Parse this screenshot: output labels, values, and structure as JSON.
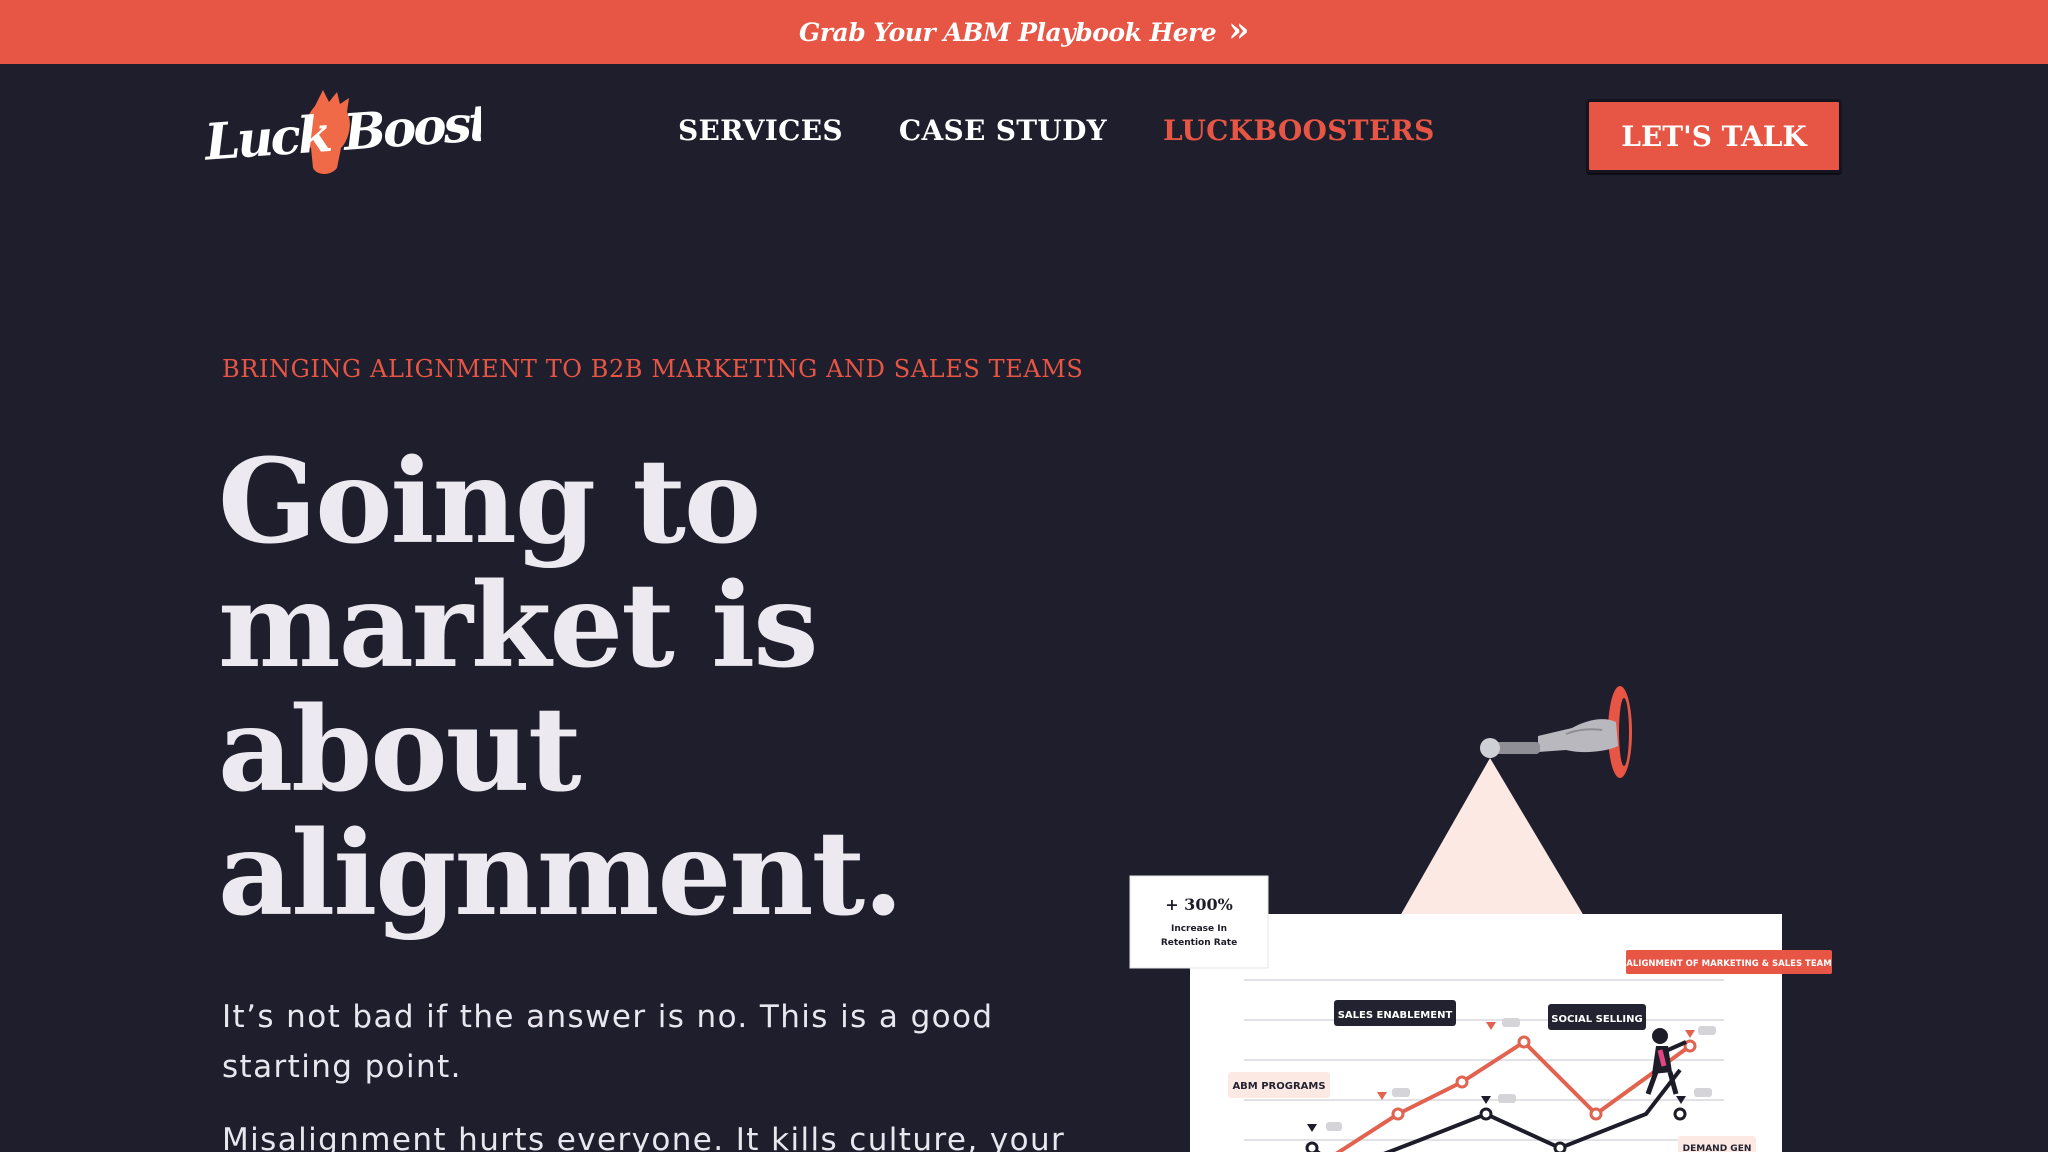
{
  "announcement": {
    "text": "Grab Your ABM Playbook Here",
    "icon": "double-chevron-right-icon"
  },
  "logo": {
    "text": "Luck Boosters",
    "accent_color": "#f06a47"
  },
  "nav": {
    "items": [
      {
        "label": "SERVICES"
      },
      {
        "label": "CASE STUDY"
      },
      {
        "label": "LUCKBOOSTERS"
      }
    ]
  },
  "cta": {
    "label": "LET'S TALK"
  },
  "hero": {
    "eyebrow": "BRINGING ALIGNMENT TO B2B MARKETING AND SALES TEAMS",
    "title": "Going to market is about alignment.",
    "paragraph1": "It’s not bad if the answer is no. This is a good starting point.",
    "paragraph2": "Misalignment hurts everyone. It kills culture, your"
  },
  "illustration": {
    "stat_value": "+ 300%",
    "stat_caption_line1": "Increase In",
    "stat_caption_line2": "Retention Rate",
    "banner": "ALIGNMENT OF MARKETING & SALES TEAM",
    "labels": {
      "sales_enablement": "SALES ENABLEMENT",
      "social_selling": "SOCIAL SELLING",
      "abm_programs": "ABM PROGRAMS",
      "demand_gen": "DEMAND GEN"
    }
  },
  "colors": {
    "accent": "#e75645",
    "background": "#1f1e2c",
    "text": "#eceaf0"
  }
}
